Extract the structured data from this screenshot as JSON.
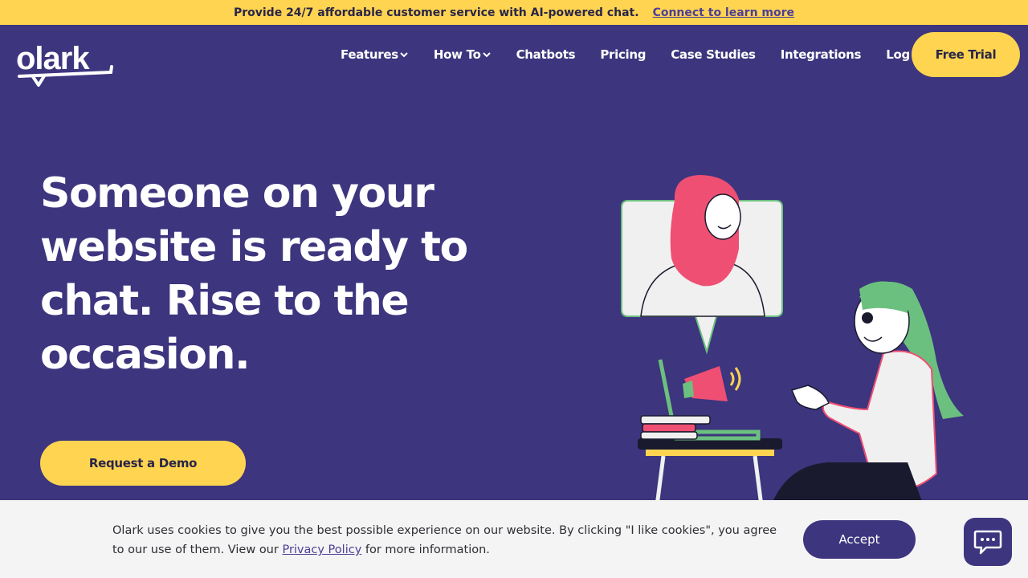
{
  "banner": {
    "message": "Provide 24/7 affordable customer service with AI-powered chat.",
    "link": "Connect to learn more"
  },
  "header": {
    "logo_text": "olark",
    "nav": [
      {
        "label": "Features",
        "icon": "chevron-down-icon"
      },
      {
        "label": "How To",
        "icon": "chevron-down-icon"
      },
      {
        "label": "Chatbots"
      },
      {
        "label": "Pricing"
      },
      {
        "label": "Case Studies"
      },
      {
        "label": "Integrations"
      },
      {
        "label": "Log in"
      }
    ],
    "cta": "Free Trial"
  },
  "hero": {
    "title": "Someone on your website is ready to chat. Rise to the occasion.",
    "button": "Request a Demo"
  },
  "cookie": {
    "text_before": "Olark uses cookies to give you the best possible experience on our website. By clicking \"I like cookies\", you agree to our use of them. View our ",
    "link": "Privacy Policy",
    "text_after": " for more information.",
    "accept": "Accept"
  },
  "chat_launcher": {
    "icon": "chat-bubble-icon"
  },
  "colors": {
    "brand_purple": "#3d357e",
    "accent_yellow": "#fed451",
    "hijab_pink": "#ef4f73",
    "hair_green": "#6cc07f"
  }
}
